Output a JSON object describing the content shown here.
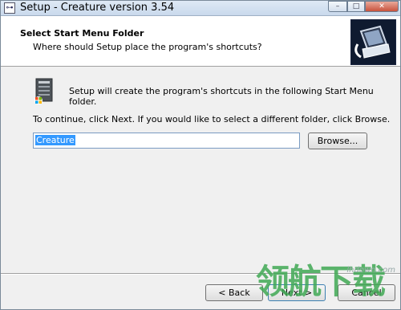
{
  "window": {
    "title": "Setup - Creature version 3.54",
    "app_icon_glyph": "⊶"
  },
  "caption_buttons": {
    "minimize": "–",
    "maximize": "□",
    "close": "✕"
  },
  "header": {
    "title": "Select Start Menu Folder",
    "subtitle": "Where should Setup place the program's shortcuts?"
  },
  "body": {
    "intro": "Setup will create the program's shortcuts in the following Start Menu folder.",
    "instructions": "To continue, click Next. If you would like to select a different folder, click Browse.",
    "folder_value": "Creature",
    "browse_label": "Browse..."
  },
  "footer": {
    "back_label": "< Back",
    "next_label": "Next >",
    "cancel_label": "Cancel"
  },
  "watermark": {
    "text": "领航下载",
    "url": "lhdown.com"
  },
  "icons": [
    "app-icon",
    "setup-computer-icon",
    "start-menu-folder-icon"
  ]
}
